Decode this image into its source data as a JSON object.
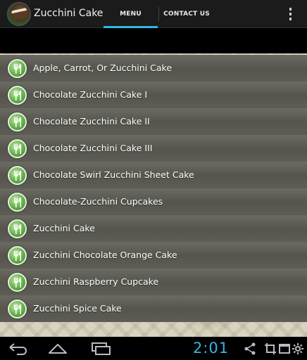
{
  "app": {
    "title": "Zucchini Cake",
    "icon": "cake-icon"
  },
  "tabs": [
    {
      "label": "MENU",
      "selected": true
    },
    {
      "label": "CONTACT US",
      "selected": false
    }
  ],
  "overflow_menu": {
    "icon": "overflow-menu-icon"
  },
  "recipes": [
    {
      "label": "Apple, Carrot, Or Zucchini Cake"
    },
    {
      "label": "Chocolate Zucchini Cake I"
    },
    {
      "label": "Chocolate Zucchini Cake II"
    },
    {
      "label": "Chocolate Zucchini Cake III"
    },
    {
      "label": "Chocolate Swirl Zucchini Sheet Cake"
    },
    {
      "label": "Chocolate-Zucchini Cupcakes"
    },
    {
      "label": "Zucchini Cake"
    },
    {
      "label": "Zucchini Chocolate Orange Cake"
    },
    {
      "label": "Zucchini Raspberry Cupcake"
    },
    {
      "label": "Zucchini Spice Cake"
    }
  ],
  "list_icon": "fork-knife-icon",
  "system_bar": {
    "clock": "2:01",
    "nav_icons": [
      "back-icon",
      "home-icon",
      "recent-apps-icon"
    ],
    "status_icons": [
      "share-icon",
      "screenshot-icon",
      "window-icon",
      "settings-icon"
    ]
  },
  "colors": {
    "accent": "#33b5e5",
    "row": "#5d5d55",
    "icon_green": "#63b04a"
  }
}
